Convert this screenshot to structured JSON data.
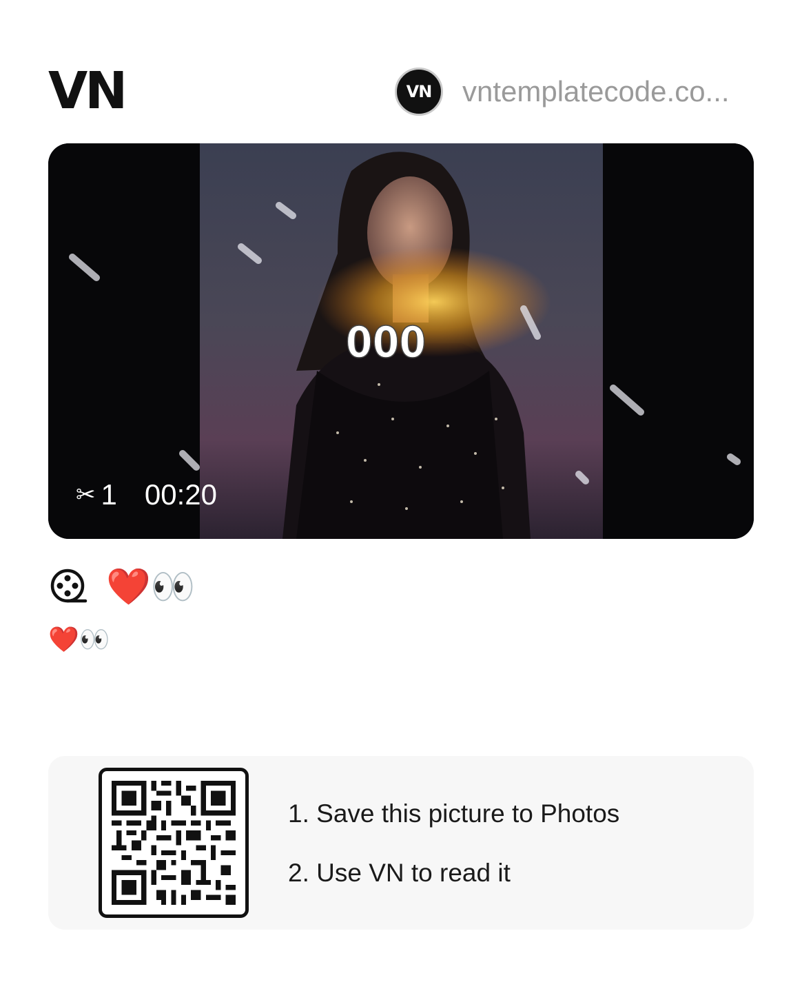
{
  "header": {
    "logo": "VN",
    "author_avatar_text": "VN",
    "author_name": "vntemplatecode.co..."
  },
  "video": {
    "overlay_text": "000",
    "clip_count": "1",
    "duration": "00:20",
    "scissors_icon": "✂"
  },
  "template": {
    "title": "❤️👀",
    "description": "❤️👀"
  },
  "qr": {
    "step1": "1. Save this picture to Photos",
    "step2": "2. Use VN to read it"
  },
  "colors": {
    "background": "#ffffff",
    "card_background": "#f7f7f7",
    "author_text": "#9a9a9a"
  }
}
